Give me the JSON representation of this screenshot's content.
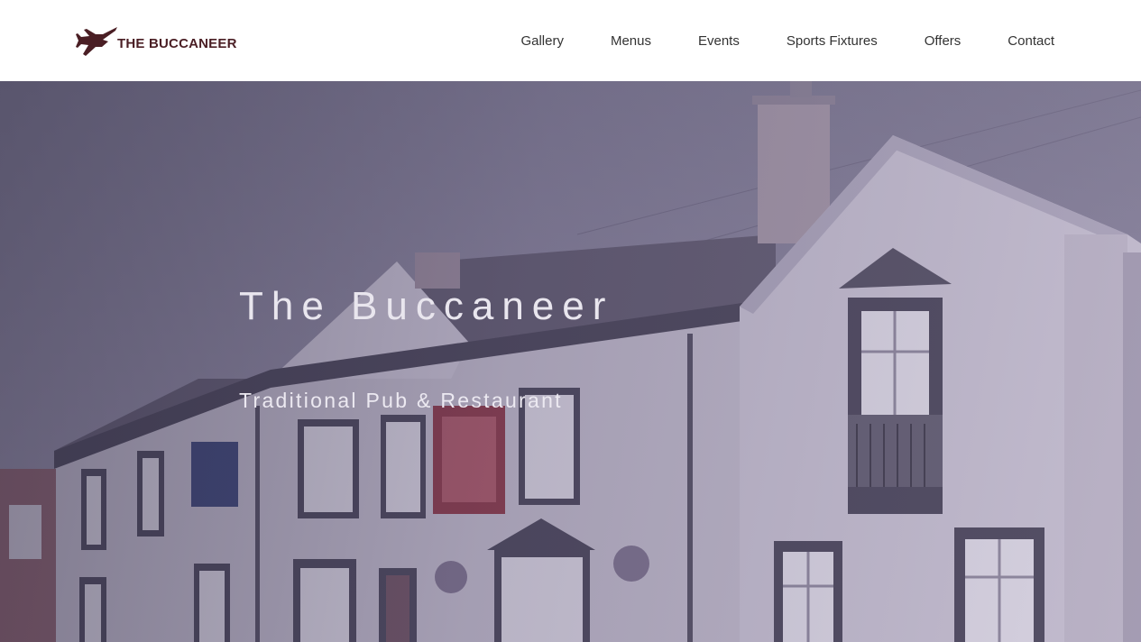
{
  "header": {
    "logo_text": "THE BUCCANEER",
    "logo_icon": "jet-aircraft-icon",
    "brand_color": "#4a1e24"
  },
  "nav": {
    "items": [
      {
        "label": "Gallery"
      },
      {
        "label": "Menus"
      },
      {
        "label": "Events"
      },
      {
        "label": "Sports Fixtures"
      },
      {
        "label": "Offers"
      },
      {
        "label": "Contact"
      }
    ]
  },
  "hero": {
    "title": "The Buccaneer",
    "subtitle": "Traditional Pub & Restaurant",
    "overlay_color": "#5a5478"
  }
}
